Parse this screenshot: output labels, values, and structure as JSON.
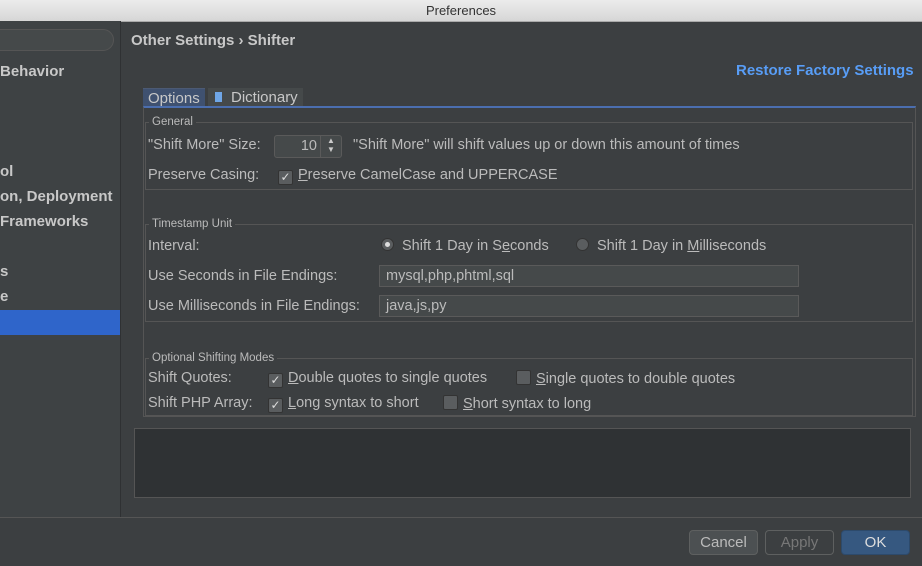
{
  "window": {
    "title": "Preferences"
  },
  "sidebar": {
    "items": [
      {
        "label": "Behavior"
      },
      {
        "label": "ol"
      },
      {
        "label": "on, Deployment"
      },
      {
        "label": "Frameworks"
      },
      {
        "label": "s"
      },
      {
        "label": "e"
      }
    ],
    "selected_color": "#2f65ca"
  },
  "header": {
    "breadcrumb": "Other Settings › Shifter",
    "restore": "Restore Factory Settings"
  },
  "tabs": [
    {
      "label": "Options",
      "active": true
    },
    {
      "label": "Dictionary",
      "icon": "document-icon"
    }
  ],
  "general": {
    "title": "General",
    "shift_more_label": "\"Shift More\" Size:",
    "shift_more_value": "10",
    "shift_more_desc": "\"Shift More\" will shift values up or down this amount of times",
    "preserve_label": "Preserve Casing:",
    "preserve_pre": "P",
    "preserve_rest": "reserve CamelCase and UPPERCASE",
    "preserve_checked": true
  },
  "timestamp": {
    "title": "Timestamp Unit",
    "interval_label": "Interval:",
    "opt1_a": "Shift 1 Day in S",
    "opt1_u": "e",
    "opt1_b": "conds",
    "opt1_selected": true,
    "opt2_a": "Shift 1 Day in ",
    "opt2_u": "M",
    "opt2_b": "illiseconds",
    "seconds_label": "Use Seconds in File Endings:",
    "seconds_value": "mysql,php,phtml,sql",
    "ms_label": "Use Milliseconds in File Endings:",
    "ms_value": "java,js,py"
  },
  "modes": {
    "title": "Optional Shifting Modes",
    "quotes_label": "Shift Quotes:",
    "q1_u": "D",
    "q1": "ouble quotes to single quotes",
    "q1_checked": true,
    "q2_u": "S",
    "q2": "ingle quotes to double quotes",
    "q2_checked": false,
    "array_label": "Shift PHP Array:",
    "a1_u": "L",
    "a1": "ong syntax to short",
    "a1_checked": true,
    "a2_u": "S",
    "a2": "hort syntax to long",
    "a2_checked": false
  },
  "buttons": {
    "cancel": "Cancel",
    "apply": "Apply",
    "ok": "OK"
  }
}
